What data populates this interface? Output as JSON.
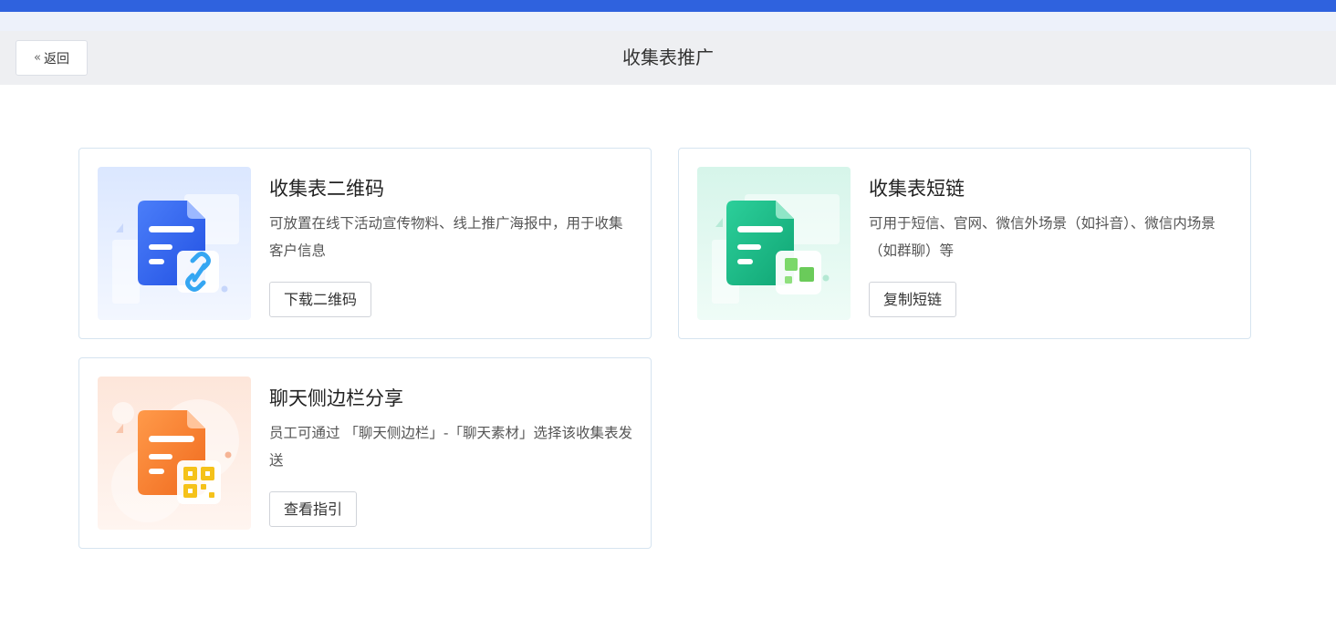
{
  "header": {
    "back_label": "返回",
    "title": "收集表推广"
  },
  "cards": [
    {
      "title": "收集表二维码",
      "description": "可放置在线下活动宣传物料、线上推广海报中，用于收集客户信息",
      "button_label": "下载二维码",
      "icon": "document-link-icon",
      "accent": "#2f62f0"
    },
    {
      "title": "收集表短链",
      "description": "可用于短信、官网、微信外场景（如抖音）、微信内场景（如群聊）等",
      "button_label": "复制短链",
      "icon": "document-shortlink-icon",
      "accent": "#17b887"
    },
    {
      "title": "聊天侧边栏分享",
      "description": "员工可通过 「聊天侧边栏」-「聊天素材」选择该收集表发送",
      "button_label": "查看指引",
      "icon": "document-qrcode-icon",
      "accent": "#f57a2c"
    }
  ],
  "colors": {
    "topbar": "#2f62de",
    "header_bg": "#eeeff2",
    "card_border": "#d6e4f0"
  }
}
